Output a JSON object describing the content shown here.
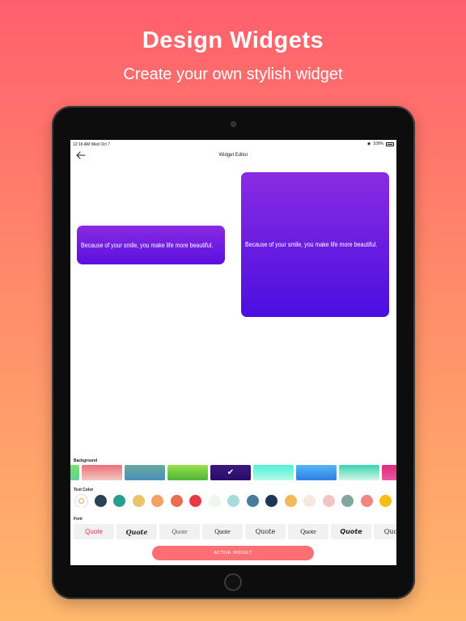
{
  "hero": {
    "title": "Design Widgets",
    "subtitle": "Create your own stylish widget"
  },
  "status_bar": {
    "time": "12:16 AM  Wed Oct 7",
    "battery": "100%"
  },
  "nav": {
    "title": "Widget Editor",
    "back_icon": "arrow-left-icon"
  },
  "widgets": {
    "small_text": "Because of your smile, you make life more beautiful.",
    "large_text": "Because of your smile, you make life more beautiful."
  },
  "sections": {
    "background_label": "Background",
    "text_color_label": "Text Color",
    "font_label": "Font"
  },
  "backgrounds": [
    {
      "from": "#7ee06a",
      "to": "#5fd2a0",
      "selected": false
    },
    {
      "from": "#ec6f7a",
      "to": "#f4c6c0",
      "selected": false
    },
    {
      "from": "#6aa8a0",
      "to": "#4c8fb8",
      "selected": false
    },
    {
      "from": "#9ae04c",
      "to": "#4cb33a",
      "selected": false
    },
    {
      "from": "#3a1a7a",
      "to": "#2a0a6a",
      "selected": true
    },
    {
      "from": "#4ff0d6",
      "to": "#b2fbe8",
      "selected": false
    },
    {
      "from": "#54b6f5",
      "to": "#2f7de6",
      "selected": false
    },
    {
      "from": "#38d3b0",
      "to": "#d3f6e8",
      "selected": false
    },
    {
      "from": "#e02a7a",
      "to": "#e85aa0",
      "selected": false
    }
  ],
  "text_colors": [
    "#ffffff",
    "#2a4152",
    "#2a9d8f",
    "#e9c46a",
    "#f4a261",
    "#e76f51",
    "#e63946",
    "#eef6ee",
    "#a8dadc",
    "#457b9d",
    "#1d3557",
    "#f2b95c",
    "#f6e8e0",
    "#f3c4c4",
    "#84a59d",
    "#f28482",
    "#f6bd17"
  ],
  "fonts": [
    {
      "label": "Quote",
      "color": "#e63946",
      "family": "\"Liberation Sans\", sans-serif",
      "style": "normal",
      "weight": "normal"
    },
    {
      "label": "Quote",
      "color": "#222222",
      "family": "\"DejaVu Serif\", serif",
      "style": "italic",
      "weight": "bold"
    },
    {
      "label": "Quote",
      "color": "#555555",
      "family": "\"Liberation Serif\", serif",
      "style": "italic",
      "weight": "normal"
    },
    {
      "label": "Quote",
      "color": "#222222",
      "family": "\"Liberation Serif\", serif",
      "style": "normal",
      "weight": "normal"
    },
    {
      "label": "Quote",
      "color": "#222222",
      "family": "\"DejaVu Serif\", serif",
      "style": "normal",
      "weight": "normal"
    },
    {
      "label": "Quote",
      "color": "#222222",
      "family": "\"Liberation Serif\", serif",
      "style": "normal",
      "weight": "normal"
    },
    {
      "label": "Quote",
      "color": "#222222",
      "family": "\"DejaVu Sans\", sans-serif",
      "style": "italic",
      "weight": "bold"
    },
    {
      "label": "Quote",
      "color": "#222222",
      "family": "\"DejaVu Serif\", serif",
      "style": "normal",
      "weight": "normal"
    },
    {
      "label": "Quote",
      "color": "#222222",
      "family": "\"DejaVu Sans Mono\", monospace",
      "style": "normal",
      "weight": "normal"
    }
  ],
  "action": {
    "active_widget_label": "ACTIVE WIDGET"
  }
}
